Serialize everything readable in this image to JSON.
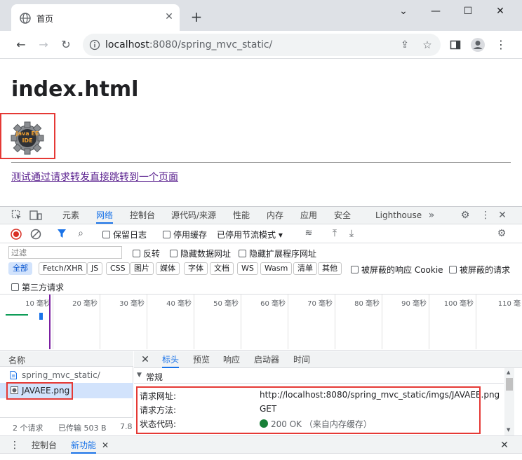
{
  "browser": {
    "tab_title": "首页",
    "new_tab": "+",
    "url_host": "localhost",
    "url_path": ":8080/spring_mvc_static/",
    "window": {
      "minimize": "⌄",
      "restore": "—",
      "maximize": "☐",
      "close": "✕"
    }
  },
  "page": {
    "heading": "index.html",
    "image_text_top": "Java EE",
    "image_text_bottom": "IDE",
    "link": "测试通过请求转发直接跳转到一个页面"
  },
  "devtools": {
    "tabs": [
      "元素",
      "网络",
      "控制台",
      "源代码/来源",
      "性能",
      "内存",
      "应用",
      "安全",
      "Lighthouse"
    ],
    "active_tab": "网络",
    "toolbar": {
      "preserve_log": "保留日志",
      "disable_cache": "停用缓存",
      "throttle": "已停用节流模式"
    },
    "filter": {
      "placeholder": "过滤",
      "invert": "反转",
      "hide_data_urls": "隐藏数据网址",
      "hide_extension_urls": "隐藏扩展程序网址"
    },
    "types": [
      "全部",
      "Fetch/XHR",
      "JS",
      "CSS",
      "图片",
      "媒体",
      "字体",
      "文档",
      "WS",
      "Wasm",
      "清单",
      "其他"
    ],
    "blocked_cookies": "被屏蔽的响应 Cookie",
    "blocked_requests": "被屏蔽的请求",
    "third_party": "第三方请求",
    "timeline_ticks": [
      "10 毫秒",
      "20 毫秒",
      "30 毫秒",
      "40 毫秒",
      "50 毫秒",
      "60 毫秒",
      "70 毫秒",
      "80 毫秒",
      "90 毫秒",
      "100 毫秒",
      "110 毫"
    ],
    "name_header": "名称",
    "requests": [
      "spring_mvc_static/",
      "JAVAEE.png"
    ],
    "detail_tabs": [
      "标头",
      "预览",
      "响应",
      "启动器",
      "时间"
    ],
    "active_detail_tab": "标头",
    "section_general": "常规",
    "general": [
      {
        "key": "请求网址:",
        "value": "http://localhost:8080/spring_mvc_static/imgs/JAVAEE.png"
      },
      {
        "key": "请求方法:",
        "value": "GET"
      },
      {
        "key": "状态代码:",
        "value": "200 OK （来自内存缓存）"
      }
    ],
    "status": {
      "requests": "2 个请求",
      "transferred": "已传输 503 B",
      "more": "7.8"
    },
    "drawer": {
      "console": "控制台",
      "whats_new": "新功能"
    }
  }
}
